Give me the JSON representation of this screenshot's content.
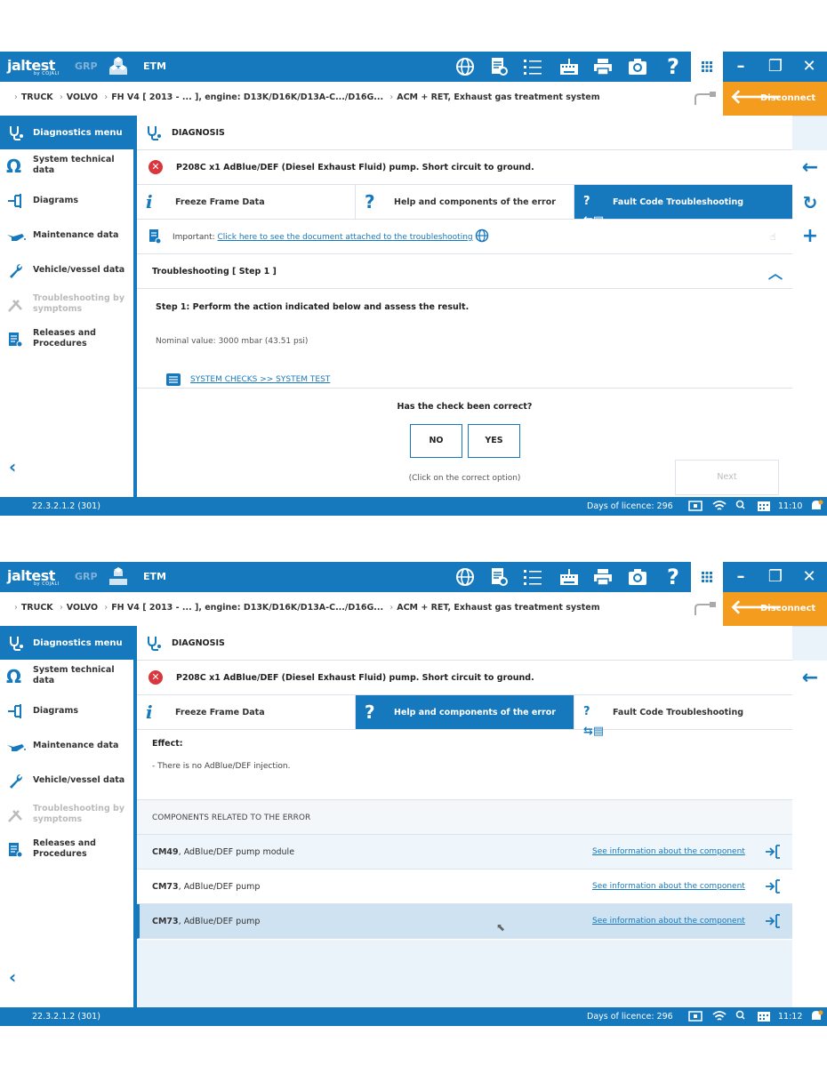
{
  "app": {
    "logo": "jaltest",
    "logo_sub": "by COJALI",
    "grp": "GRP",
    "etm": "ETM",
    "disconnect": "Disconnect",
    "breadcrumb": [
      "TRUCK",
      "VOLVO",
      "FH V4 [ 2013 - ... ], engine: D13K/D16K/D13A-C.../D16G...",
      "ACM + RET, Exhaust gas treatment system"
    ],
    "accent_color": "#1679be",
    "orange_color": "#f39c1e"
  },
  "sidebar": {
    "header": "Diagnostics menu",
    "items": [
      {
        "label": "System technical data",
        "icon": "omega-icon"
      },
      {
        "label": "Diagrams",
        "icon": "diagram-icon"
      },
      {
        "label": "Maintenance data",
        "icon": "oil-can-icon"
      },
      {
        "label": "Vehicle/vessel data",
        "icon": "wrench-icon"
      },
      {
        "label": "Troubleshooting by symptoms",
        "icon": "tools-icon",
        "disabled": true
      },
      {
        "label": "Releases and Procedures",
        "icon": "document-icon"
      }
    ]
  },
  "diagnosis": {
    "header": "DIAGNOSIS",
    "fault": "P208C  x1  AdBlue/DEF (Diesel Exhaust Fluid) pump. Short circuit to ground.",
    "tabs": [
      "Freeze Frame Data",
      "Help and components of the error",
      "Fault Code Troubleshooting"
    ]
  },
  "screen1": {
    "active_tab": 2,
    "important_prefix": "Important: ",
    "important_link": "Click here to see the document attached to the troubleshooting",
    "troubleshooting_header": "Troubleshooting [ Step 1 ]",
    "step": "Step 1: Perform the action indicated below and assess the result.",
    "nominal": "Nominal value: 3000 mbar (43.51 psi)",
    "system_link": "SYSTEM CHECKS >> SYSTEM TEST",
    "question": "Has the check been correct?",
    "no": "NO",
    "yes": "YES",
    "hint": "(Click on the correct option)",
    "next": "Next",
    "status": {
      "version": "22.3.2.1.2 (301)",
      "licence": "Days of licence: 296",
      "time": "11:10"
    }
  },
  "screen2": {
    "active_tab": 1,
    "effect_title": "Effect:",
    "effect_text": "- There is no AdBlue/DEF injection.",
    "components_header": "COMPONENTS RELATED TO THE ERROR",
    "components": [
      {
        "code": "CM49",
        "name": ", AdBlue/DEF pump module",
        "link": "See information about the component"
      },
      {
        "code": "CM73",
        "name": ", AdBlue/DEF pump",
        "link": "See information about the component"
      },
      {
        "code": "CM73",
        "name": ", AdBlue/DEF pump",
        "link": "See information about the component",
        "selected": true
      }
    ],
    "status": {
      "version": "22.3.2.1.2 (301)",
      "licence": "Days of licence: 296",
      "time": "11:12"
    }
  }
}
